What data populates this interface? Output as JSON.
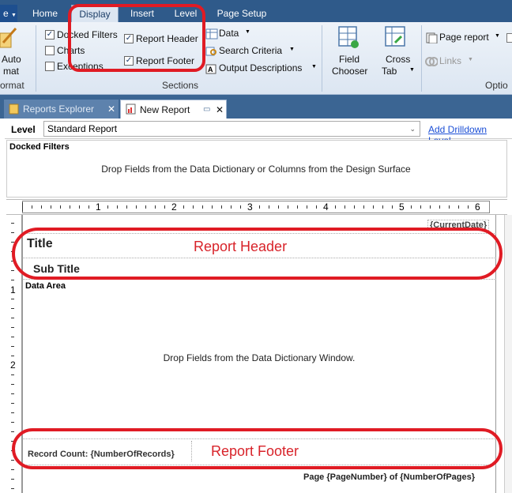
{
  "menubar": {
    "file_label": "e",
    "tabs": [
      "Home",
      "Display",
      "Insert",
      "Level",
      "Page Setup"
    ]
  },
  "ribbon": {
    "auto_format": {
      "line1": "Auto",
      "line2": "mat",
      "group": "ormat"
    },
    "checkboxes": [
      {
        "label": "Docked Filters",
        "checked": true
      },
      {
        "label": "Charts",
        "checked": false
      },
      {
        "label": "Exceptions",
        "checked": false
      },
      {
        "label": "Report Header",
        "checked": true
      },
      {
        "label": "Report Footer",
        "checked": true
      }
    ],
    "data_label": "Data",
    "search_criteria_label": "Search Criteria",
    "output_descriptions_label": "Output Descriptions",
    "sections_label": "Sections",
    "field_chooser": {
      "line1": "Field",
      "line2": "Chooser"
    },
    "cross_tab": {
      "line1": "Cross",
      "line2": "Tab"
    },
    "page_report_label": "Page report",
    "links_label": "Links",
    "options_label": "Optio"
  },
  "doc_tabs": [
    "Reports Explorer",
    "New Report"
  ],
  "level": {
    "label": "Level",
    "value": "Standard Report",
    "add_drilldown": "Add Drilldown Level"
  },
  "docked_filters": {
    "title": "Docked Filters",
    "hint": "Drop Fields from the Data Dictionary or Columns from the Design Surface"
  },
  "ruler": {
    "labels": [
      "1",
      "2",
      "3",
      "4",
      "5",
      "6"
    ],
    "vlabels": [
      "1",
      "2"
    ]
  },
  "design": {
    "current_date": "{CurrentDate}",
    "title": "Title",
    "subtitle": "Sub Title",
    "data_area": "Data Area",
    "data_hint": "Drop Fields from the Data Dictionary Window.",
    "record_count": "Record Count: {NumberOfRecords}",
    "page_number": "Page {PageNumber} of {NumberOfPages}"
  },
  "annotations": {
    "report_header": "Report Header",
    "report_footer": "Report Footer"
  },
  "colors": {
    "accent_red": "#e01b24",
    "ribbon_blue": "#2f5a8a"
  }
}
